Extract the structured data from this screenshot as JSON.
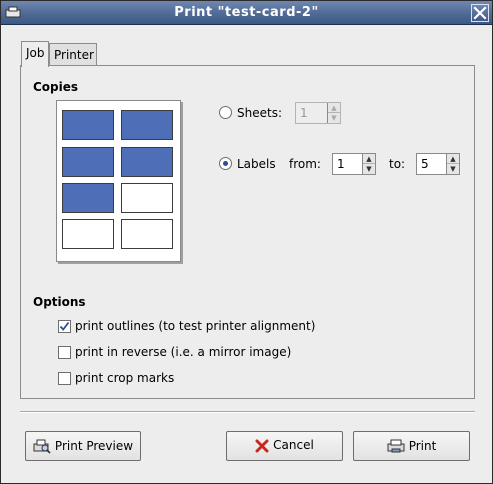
{
  "window": {
    "title": "Print \"test-card-2\"",
    "close_icon": "close-icon",
    "app_icon": "printer-window-icon"
  },
  "tabs": [
    {
      "label": "Job",
      "active": true
    },
    {
      "label": "Printer",
      "active": false
    }
  ],
  "copies": {
    "heading": "Copies",
    "sheets_label": "Sheets:",
    "sheets_value": "1",
    "labels_label": "Labels",
    "from_label": "from:",
    "from_value": "1",
    "to_label": "to:",
    "to_value": "5",
    "selected": "labels"
  },
  "preview": {
    "rows": 4,
    "columns": 2,
    "filled_cells": 5,
    "fill_color": "#4e6fb7"
  },
  "options": {
    "heading": "Options",
    "items": [
      {
        "label": "print outlines (to test printer alignment)",
        "checked": true
      },
      {
        "label": "print in reverse (i.e. a mirror image)",
        "checked": false
      },
      {
        "label": "print crop marks",
        "checked": false
      }
    ]
  },
  "buttons": {
    "preview": "Print Preview",
    "cancel": "Cancel",
    "print": "Print"
  },
  "colors": {
    "title_bar": "#556f9a",
    "cancel_icon": "#c8281e",
    "check": "#2b4d92"
  }
}
